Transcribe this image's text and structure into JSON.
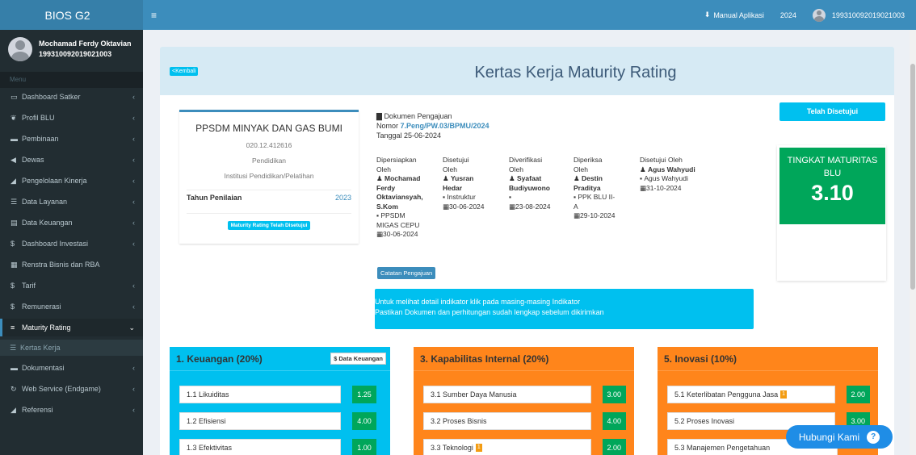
{
  "app": {
    "logo": "BIOS G2"
  },
  "user": {
    "name": "Mochamad Ferdy Oktavian",
    "nip": "199310092019021003"
  },
  "sidebar": {
    "menu_header": "Menu",
    "items": [
      {
        "icon": "monitor-icon",
        "label": "Dashboard Satker",
        "chevron": "‹"
      },
      {
        "icon": "flag-icon",
        "label": "Profil BLU",
        "chevron": "‹"
      },
      {
        "icon": "car-icon",
        "label": "Pembinaan",
        "chevron": "‹"
      },
      {
        "icon": "bullhorn-icon",
        "label": "Dewas",
        "chevron": "‹"
      },
      {
        "icon": "book-icon",
        "label": "Pengelolaan Kinerja",
        "chevron": "‹"
      },
      {
        "icon": "list-icon",
        "label": "Data Layanan",
        "chevron": "‹"
      },
      {
        "icon": "file-money-icon",
        "label": "Data Keuangan",
        "chevron": "‹"
      },
      {
        "icon": "dollar-icon",
        "label": "Dashboard Investasi",
        "chevron": "‹"
      },
      {
        "icon": "document-icon",
        "label": "Renstra Bisnis dan RBA",
        "chevron": ""
      },
      {
        "icon": "dollar-icon",
        "label": "Tarif",
        "chevron": "‹"
      },
      {
        "icon": "dollar-icon",
        "label": "Remunerasi",
        "chevron": "‹"
      },
      {
        "icon": "bars-icon",
        "label": "Maturity Rating",
        "chevron": "⌄"
      }
    ],
    "sub_item": "Kertas Kerja",
    "items_after": [
      {
        "icon": "car-icon",
        "label": "Dokumentasi",
        "chevron": "‹"
      },
      {
        "icon": "refresh-icon",
        "label": "Web Service (Endgame)",
        "chevron": "‹"
      },
      {
        "icon": "book-icon",
        "label": "Referensi",
        "chevron": "‹"
      }
    ]
  },
  "header": {
    "toggle": "≡",
    "manual": "Manual Aplikasi",
    "year": "2024",
    "user_id": "199310092019021003"
  },
  "page": {
    "back": "<Kembali",
    "title": "Kertas Kerja Maturity Rating"
  },
  "institution": {
    "name": "PPSDM MINYAK DAN GAS BUMI",
    "code": "020.12.412616",
    "type": "Pendidikan",
    "kind": "Institusi Pendidikan/Pelatihan",
    "year_label": "Tahun Penilaian",
    "year": "2023",
    "badge": "Maturity Rating Telah Disetujui"
  },
  "document": {
    "label": "Dokumen Pengajuan",
    "number_prefix": "Nomor ",
    "number": "7.Peng/PW.03/BPMU/2024",
    "date": "Tanggal 25-06-2024"
  },
  "signatures": [
    {
      "title1": "Dipersiapkan",
      "title2": "Oleh",
      "name": [
        "Mochamad",
        "Ferdy",
        "Oktaviansyah,",
        "S.Kom"
      ],
      "role": [
        "PPSDM",
        "MIGAS CEPU"
      ],
      "date": "30-06-2024"
    },
    {
      "title1": "Disetujui",
      "title2": "Oleh",
      "name": [
        "Yusran",
        "Hedar"
      ],
      "role": [
        "Instruktur"
      ],
      "date": "30-06-2024"
    },
    {
      "title1": "Diverifikasi",
      "title2": "Oleh",
      "name": [
        "Syafaat",
        "Budiyuwono"
      ],
      "role": [
        ""
      ],
      "date": "23-08-2024"
    },
    {
      "title1": "Diperiksa",
      "title2": "Oleh",
      "name": [
        "Destin",
        "Praditya"
      ],
      "role": [
        "PPK BLU II-",
        "A"
      ],
      "date": "29-10-2024"
    },
    {
      "title1": "Disetujui Oleh",
      "title2": "",
      "name": [
        "Agus Wahyudi"
      ],
      "role": [
        "Agus Wahyudi"
      ],
      "date": "31-10-2024"
    }
  ],
  "note_button": "Catatan Pengajuan",
  "callout": {
    "line1": "Untuk melihat detail indikator klik pada masing-masing Indikator",
    "line2": "Pastikan Dokumen dan perhitungan sudah lengkap sebelum dikirimkan"
  },
  "status_button": "Telah Disetujui",
  "maturity": {
    "label": "TINGKAT MATURITAS BLU",
    "value": "3.10"
  },
  "dimensions": [
    {
      "title": "1. Keuangan (20%)",
      "color": "#00c0ef",
      "button": "$ Data Keuangan",
      "indicators": [
        {
          "label": "1.1 Likuiditas",
          "value": "1.25",
          "badge": ""
        },
        {
          "label": "1.2 Efisiensi",
          "value": "4.00",
          "badge": ""
        },
        {
          "label": "1.3 Efektivitas",
          "value": "1.00",
          "badge": ""
        }
      ]
    },
    {
      "title": "3. Kapabilitas Internal (20%)",
      "color": "#ff851b",
      "button": "",
      "indicators": [
        {
          "label": "3.1 Sumber Daya Manusia",
          "value": "3.00",
          "badge": ""
        },
        {
          "label": "3.2 Proses Bisnis",
          "value": "4.00",
          "badge": ""
        },
        {
          "label": "3.3 Teknologi",
          "value": "2.00",
          "badge": "1"
        }
      ]
    },
    {
      "title": "5. Inovasi (10%)",
      "color": "#ff851b",
      "button": "",
      "indicators": [
        {
          "label": "5.1 Keterlibatan Pengguna Jasa",
          "value": "2.00",
          "badge": "1"
        },
        {
          "label": "5.2 Proses Inovasi",
          "value": "3.00",
          "badge": ""
        },
        {
          "label": "5.3 Manajemen Pengetahuan",
          "value": "",
          "badge": ""
        }
      ]
    }
  ],
  "help": {
    "label": "Hubungi Kami",
    "icon": "?"
  }
}
